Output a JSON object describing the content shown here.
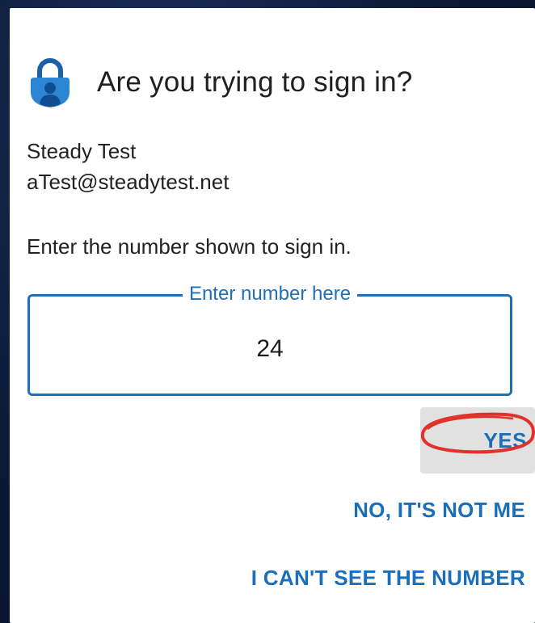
{
  "prompt": {
    "title": "Are you trying to sign in?",
    "account_name": "Steady Test",
    "account_email": "aTest@steadytest.net",
    "instruction": "Enter the number shown to sign in."
  },
  "number_field": {
    "label": "Enter number here",
    "value": "24"
  },
  "actions": {
    "yes_label": "YES",
    "no_label": "NO, IT'S NOT ME",
    "cant_see_label": "I CAN'T SEE THE NUMBER"
  },
  "colors": {
    "accent": "#1f6fba",
    "annotation": "#e0322b",
    "background": "#0b1733"
  },
  "icons": {
    "app_icon": "lock-icon",
    "annotation": "red-circle-highlight"
  }
}
